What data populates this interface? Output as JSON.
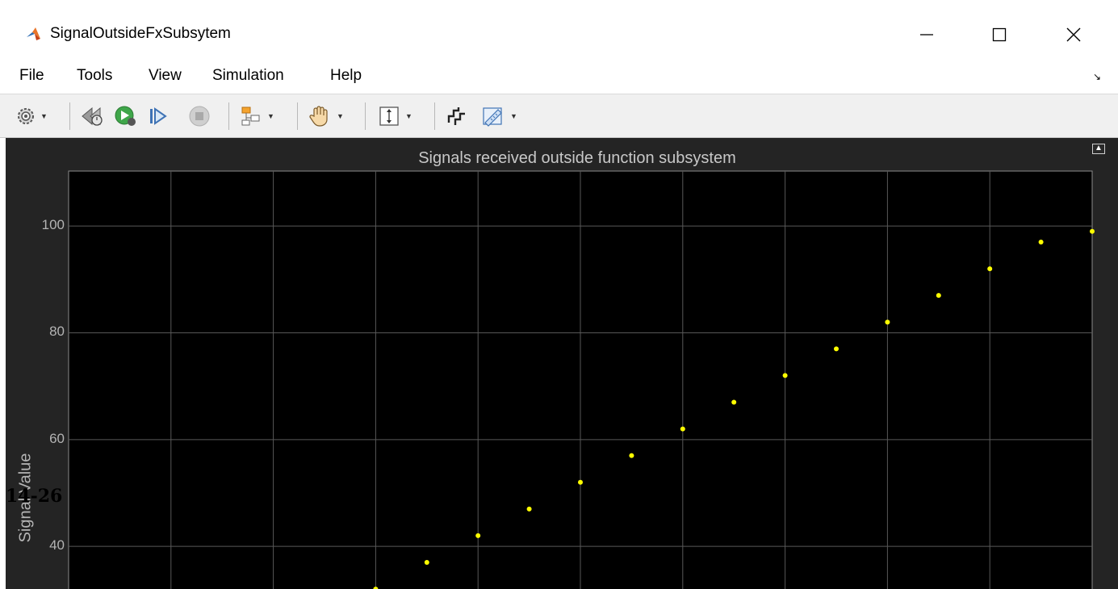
{
  "window": {
    "title": "SignalOutsideFxSubsytem",
    "controls": {
      "minimize": "—",
      "maximize": "☐",
      "close": "✕"
    }
  },
  "menu": {
    "items": [
      {
        "label": "File"
      },
      {
        "label": "Tools"
      },
      {
        "label": "View"
      },
      {
        "label": "Simulation"
      },
      {
        "label": "Help"
      }
    ],
    "corner_icon": "↘"
  },
  "toolbar": {
    "buttons": [
      {
        "icon": "settings-gear-icon"
      },
      {
        "icon": "step-back-icon"
      },
      {
        "icon": "run-icon"
      },
      {
        "icon": "step-forward-icon"
      },
      {
        "icon": "stop-icon"
      },
      {
        "icon": "signal-triggers-icon"
      },
      {
        "icon": "pan-hand-icon"
      },
      {
        "icon": "scale-axes-icon"
      },
      {
        "icon": "cursor-measurements-icon"
      },
      {
        "icon": "measurement-ruler-icon"
      }
    ]
  },
  "note": "14-26",
  "chart_data": {
    "type": "scatter",
    "title": "Signals received outside function subsystem",
    "ylabel": "Signal Value",
    "xlabel": "",
    "ylim": [
      30.2,
      110.3
    ],
    "yticks": [
      40,
      60,
      80,
      100
    ],
    "x_gridlines": 10,
    "grid": true,
    "background": "#000000",
    "marker_color": "#ffff00",
    "points": [
      {
        "x": 6,
        "y": 32
      },
      {
        "x": 7,
        "y": 37
      },
      {
        "x": 8,
        "y": 42
      },
      {
        "x": 9,
        "y": 47
      },
      {
        "x": 10,
        "y": 52
      },
      {
        "x": 11,
        "y": 57
      },
      {
        "x": 12,
        "y": 62
      },
      {
        "x": 13,
        "y": 67
      },
      {
        "x": 14,
        "y": 72
      },
      {
        "x": 15,
        "y": 77
      },
      {
        "x": 16,
        "y": 82
      },
      {
        "x": 17,
        "y": 87
      },
      {
        "x": 18,
        "y": 92
      },
      {
        "x": 19,
        "y": 97
      },
      {
        "x": 20,
        "y": 99
      }
    ],
    "xlim": [
      0,
      20
    ]
  }
}
